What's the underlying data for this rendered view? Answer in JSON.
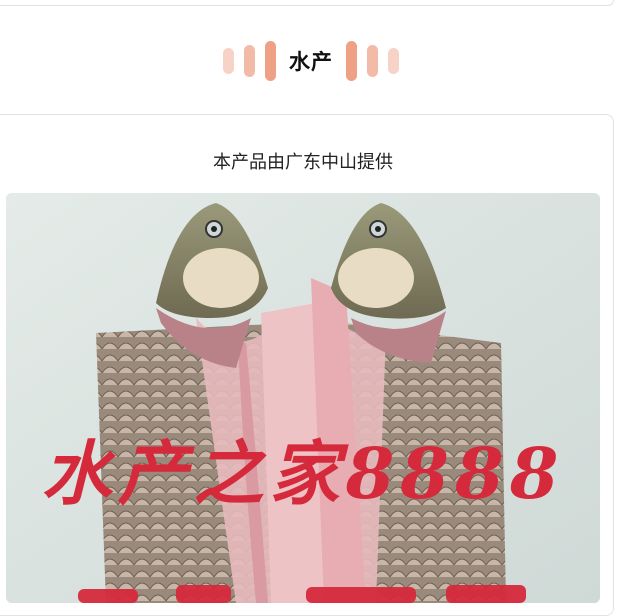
{
  "section": {
    "title": "水产"
  },
  "product": {
    "origin_text": "本产品由广东中山提供",
    "watermark_text": "水产之家8888",
    "watermark_color": "#d52a3c"
  },
  "icons": {
    "decor_left": "pill-bars",
    "decor_right": "pill-bars"
  }
}
